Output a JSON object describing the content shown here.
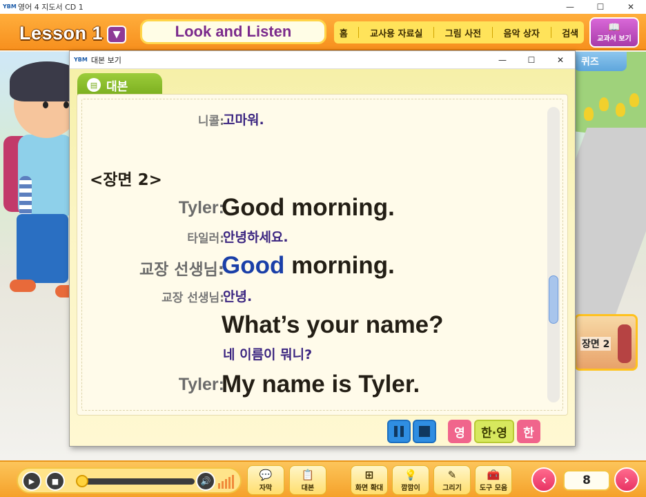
{
  "window": {
    "title": "영어 4 지도서 CD 1",
    "logo": "YBM",
    "minimize": "—",
    "maximize": "☐",
    "close": "✕"
  },
  "header": {
    "lesson": "Lesson 1",
    "lesson_dropdown_icon": "chevron-down-icon",
    "section_title": "Look and Listen",
    "nav": [
      "홈",
      "교사용 자료실",
      "그림 사전",
      "음악 상자",
      "검색"
    ],
    "textbook_button": "교과서 보기"
  },
  "side": {
    "quiz_tab": "퀴즈",
    "scene_thumb_label": "장면 2"
  },
  "dialog": {
    "title": "대본 보기",
    "logo": "YBM",
    "minimize": "—",
    "maximize": "☐",
    "close": "✕",
    "tab_label": "대본",
    "script": {
      "prev_speaker": "니콜:",
      "prev_kr": "고마워.",
      "scene_heading": "<장면 2>",
      "lines": [
        {
          "speaker": "Tyler:",
          "en": "Good morning.",
          "speaker_kr": "타일러:",
          "kr": "안녕하세요."
        },
        {
          "speaker": "교장 선생님:",
          "en_highlight": "Good",
          "en_rest": " morning.",
          "speaker_kr": "교장 선생님:",
          "kr": "안녕."
        },
        {
          "en": "What’s your name?",
          "kr": "네 이름이 뭐니?"
        },
        {
          "speaker": "Tyler:",
          "en": "My name is Tyler."
        }
      ]
    },
    "controls": {
      "pause_icon": "pause-icon",
      "stop_icon": "stop-icon",
      "lang_en": "영",
      "lang_both": "한·영",
      "lang_kr": "한"
    }
  },
  "toolbar": {
    "tools": [
      {
        "label": "자막",
        "icon": "subtitle-icon"
      },
      {
        "label": "대본",
        "icon": "script-icon"
      },
      {
        "label": "화면 확대",
        "icon": "zoom-icon"
      },
      {
        "label": "깜깜이",
        "icon": "lightbulb-icon"
      },
      {
        "label": "그리기",
        "icon": "pencil-icon"
      },
      {
        "label": "도구 모음",
        "icon": "toolbox-icon"
      }
    ],
    "page": "8",
    "prev": "‹",
    "next": "›"
  },
  "colors": {
    "accent_orange": "#f7901e",
    "purple": "#7b2a8c",
    "script_kr": "#3a2480",
    "highlight_blue": "#1a3fa8",
    "green_tab": "#79ad1e",
    "pink": "#f0658c"
  }
}
